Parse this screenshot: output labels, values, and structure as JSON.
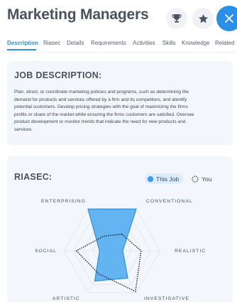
{
  "header": {
    "title": "Marketing Managers"
  },
  "tabs": [
    {
      "label": "Description",
      "active": true
    },
    {
      "label": "Riasec"
    },
    {
      "label": "Details"
    },
    {
      "label": "Requirements"
    },
    {
      "label": "Activities"
    },
    {
      "label": "Skills"
    },
    {
      "label": "Knowledge"
    },
    {
      "label": "Related"
    }
  ],
  "job": {
    "title": "JOB DESCRIPTION:",
    "lines": [
      "Plan, direct, or coordinate marketing policies and programs, such as determining the",
      "demand for products and services offered by a firm and its competitors, and identify",
      "potential customers. Develop pricing strategies with the goal of maximizing the firms",
      "profits or share of the market while ensuring the firms customers are satisfied. Oversee",
      "product development or monitor trends that indicate the need for new products and",
      "services."
    ]
  },
  "riasec": {
    "title": "RIASEC:",
    "toggle_this_job": "This Job",
    "toggle_you": "You",
    "axes": {
      "enterprising": "ENTERPRISING",
      "conventional": "CONVENTIONAL",
      "realistic": "REALISTIC",
      "investigative": "INVESTIGATIVE",
      "artistic": "ARTISTIC",
      "social": "SOCIAL"
    },
    "colors": {
      "job_fill": "#4aa8f0",
      "job_stroke": "#2a8fe6",
      "you_stroke": "#1a1a1a"
    },
    "job_values": {
      "conventional": 1.0,
      "realistic": 0.22,
      "investigative": 0.65,
      "artistic": 0.72,
      "social": 0.26,
      "enterprising": 1.0
    },
    "you_values": {
      "conventional": 0.4,
      "realistic": 0.6,
      "investigative": 0.97,
      "artistic": 0.55,
      "social": 0.74,
      "enterprising": 0.35
    }
  }
}
